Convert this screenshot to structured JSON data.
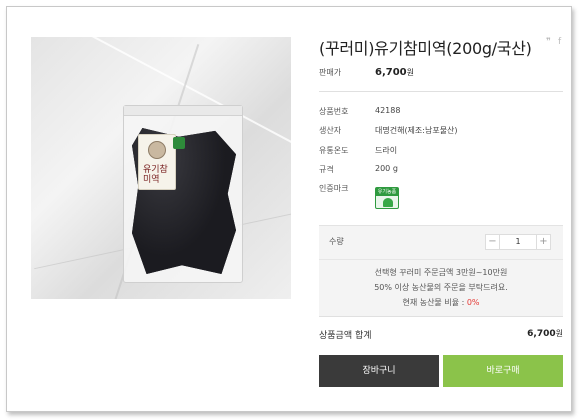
{
  "product": {
    "title": "(꾸러미)유기참미역(200g/국산)",
    "price_label": "판매가",
    "price_value": "6,700",
    "currency": "원",
    "specs": [
      {
        "key": "상품번호",
        "value": "42188"
      },
      {
        "key": "생산자",
        "value": "대명건해(제조:남포물산)"
      },
      {
        "key": "유통온도",
        "value": "드라이"
      },
      {
        "key": "규격",
        "value": "200 g"
      },
      {
        "key": "인증마크",
        "value": ""
      }
    ],
    "cert_badge_text": "유기농품",
    "package_label": "유기참미역"
  },
  "share": {
    "twitter_icon": "twitter-icon",
    "facebook_icon": "facebook-icon"
  },
  "quantity": {
    "label": "수량",
    "value": "1",
    "minus": "−",
    "plus": "+"
  },
  "notice": {
    "line1": "선택형 꾸러미 주문금액 3만원~10만원",
    "line2": "50% 이상 농산물의 주문을 부탁드려요.",
    "line3_prefix": "현재 농산물 비율 : ",
    "line3_value": "0%"
  },
  "total": {
    "label": "상품금액 합계",
    "value": "6,700",
    "currency": "원"
  },
  "buttons": {
    "cart": "장바구니",
    "buy": "바로구매"
  },
  "colors": {
    "buy": "#8bc34a",
    "cart": "#3a3a3a",
    "cert": "#2f9a3f",
    "ratio": "#e53935"
  }
}
